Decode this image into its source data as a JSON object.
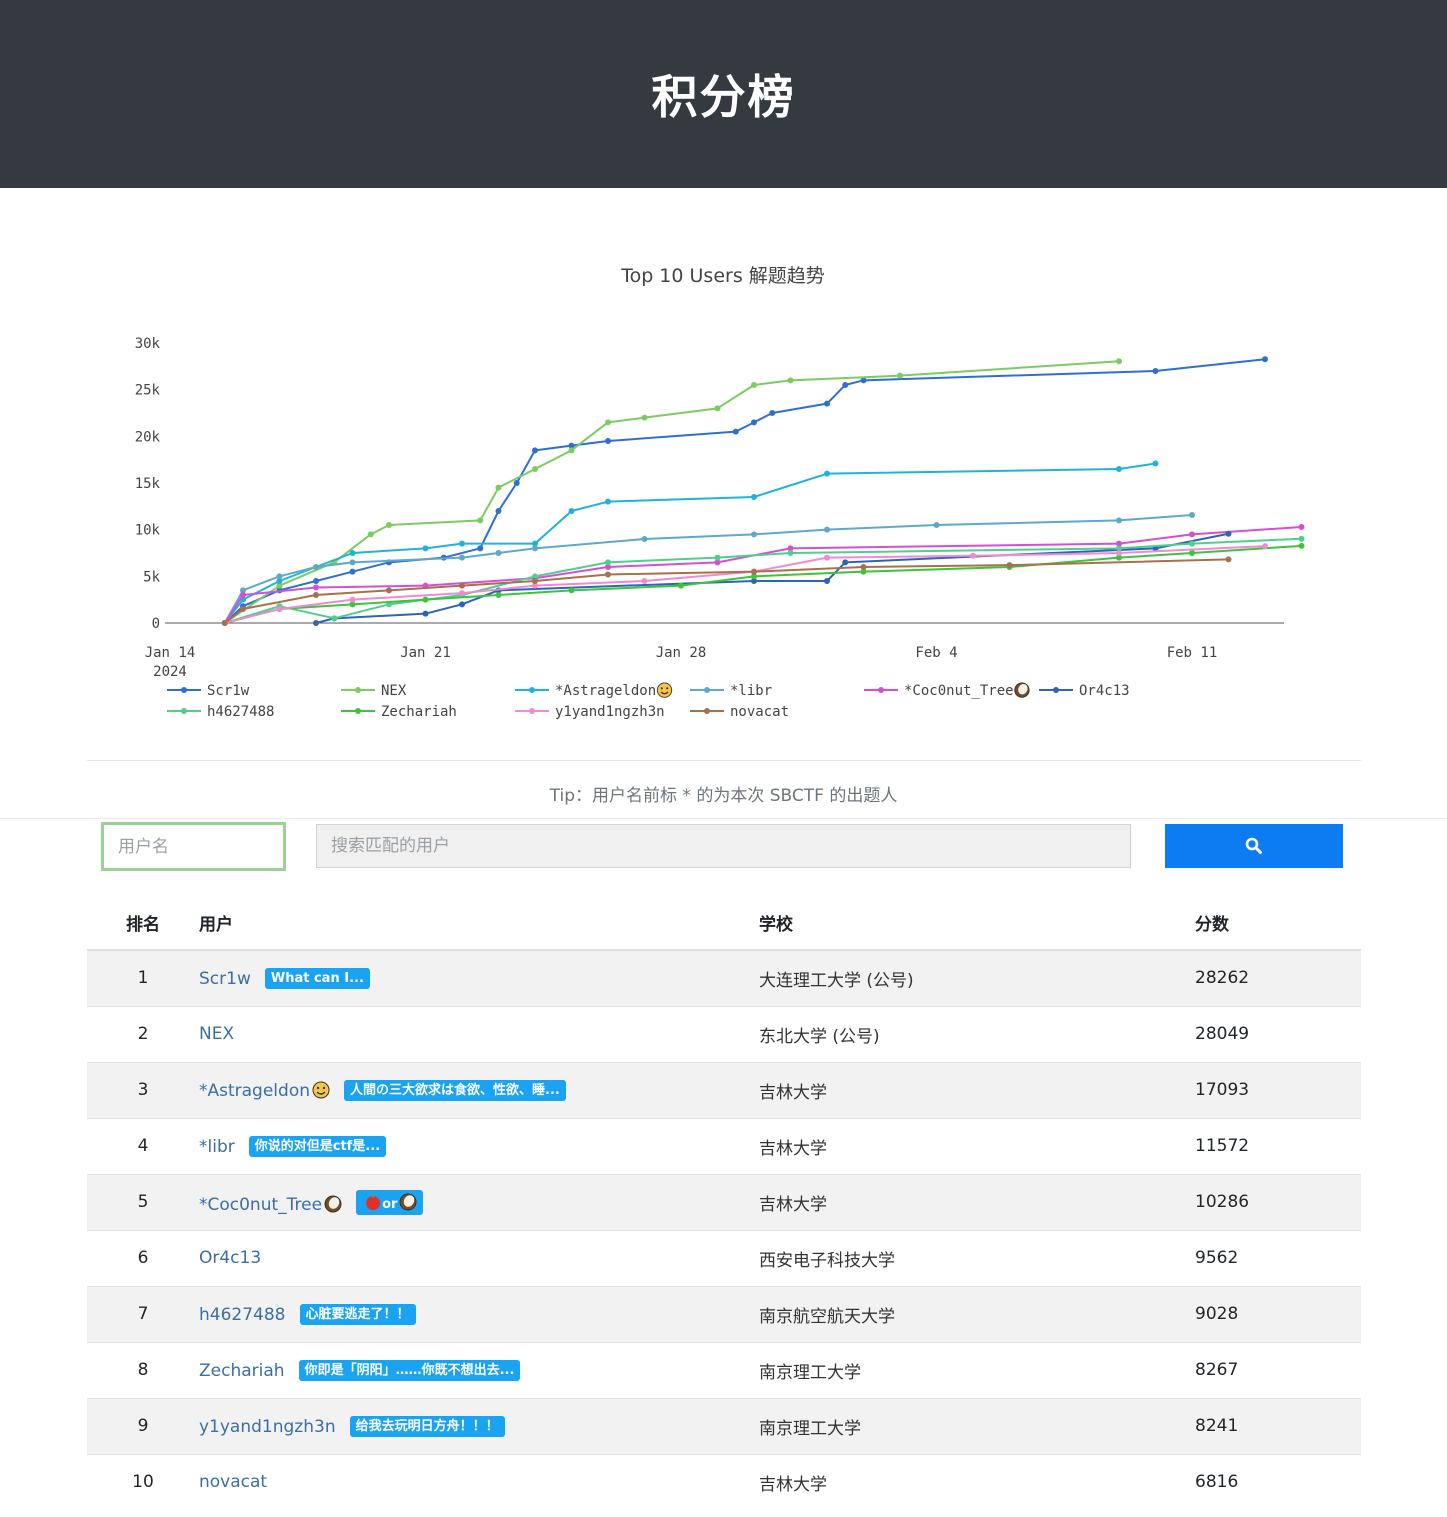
{
  "header": {
    "title": "积分榜"
  },
  "chart_data": {
    "type": "line",
    "title": "Top 10 Users 解题趋势",
    "x_ticks": [
      "Jan 14\n2024",
      "Jan 21",
      "Jan 28",
      "Feb 4",
      "Feb 11"
    ],
    "y_ticks": [
      "0",
      "5k",
      "10k",
      "15k",
      "20k",
      "25k",
      "30k"
    ],
    "ylim": [
      0,
      30000
    ],
    "xlim": [
      "2024-01-14",
      "2024-02-14"
    ],
    "grid": false,
    "legend_position": "bottom",
    "series": [
      {
        "name": "Scr1w",
        "color": "#2e6fd1",
        "points": [
          [
            "2024-01-15T12:00",
            0
          ],
          [
            "2024-01-16T00:00",
            1800
          ],
          [
            "2024-01-17T00:00",
            3500
          ],
          [
            "2024-01-18T00:00",
            4500
          ],
          [
            "2024-01-19T00:00",
            5500
          ],
          [
            "2024-01-20T00:00",
            6500
          ],
          [
            "2024-01-21T12:00",
            7000
          ],
          [
            "2024-01-22T12:00",
            8000
          ],
          [
            "2024-01-23T00:00",
            12000
          ],
          [
            "2024-01-23T12:00",
            15000
          ],
          [
            "2024-01-24T00:00",
            18500
          ],
          [
            "2024-01-25T00:00",
            19000
          ],
          [
            "2024-01-26T00:00",
            19500
          ],
          [
            "2024-01-29T12:00",
            20500
          ],
          [
            "2024-01-30T00:00",
            21500
          ],
          [
            "2024-01-30T12:00",
            22500
          ],
          [
            "2024-02-01T00:00",
            23500
          ],
          [
            "2024-02-01T12:00",
            25500
          ],
          [
            "2024-02-02T00:00",
            26000
          ],
          [
            "2024-02-10T00:00",
            27000
          ],
          [
            "2024-02-13T00:00",
            28262
          ]
        ]
      },
      {
        "name": "NEX",
        "color": "#7ccc5f",
        "points": [
          [
            "2024-01-15T12:00",
            0
          ],
          [
            "2024-01-17T00:00",
            4000
          ],
          [
            "2024-01-18T12:00",
            6500
          ],
          [
            "2024-01-19T12:00",
            9500
          ],
          [
            "2024-01-20T00:00",
            10500
          ],
          [
            "2024-01-22T12:00",
            11000
          ],
          [
            "2024-01-23T00:00",
            14500
          ],
          [
            "2024-01-24T00:00",
            16500
          ],
          [
            "2024-01-25T00:00",
            18500
          ],
          [
            "2024-01-26T00:00",
            21500
          ],
          [
            "2024-01-27T00:00",
            22000
          ],
          [
            "2024-01-29T00:00",
            23000
          ],
          [
            "2024-01-30T00:00",
            25500
          ],
          [
            "2024-01-31T00:00",
            26000
          ],
          [
            "2024-02-03T00:00",
            26500
          ],
          [
            "2024-02-09T00:00",
            28049
          ]
        ]
      },
      {
        "name": "*Astrageldon",
        "color": "#1fb3d9",
        "points": [
          [
            "2024-01-15T12:00",
            0
          ],
          [
            "2024-01-16T00:00",
            2500
          ],
          [
            "2024-01-17T00:00",
            4500
          ],
          [
            "2024-01-19T00:00",
            7500
          ],
          [
            "2024-01-21T00:00",
            8000
          ],
          [
            "2024-01-22T00:00",
            8500
          ],
          [
            "2024-01-24T00:00",
            8500
          ],
          [
            "2024-01-25T00:00",
            12000
          ],
          [
            "2024-01-26T00:00",
            13000
          ],
          [
            "2024-01-30T00:00",
            13500
          ],
          [
            "2024-02-01T00:00",
            16000
          ],
          [
            "2024-02-09T00:00",
            16500
          ],
          [
            "2024-02-10T00:00",
            17093
          ]
        ]
      },
      {
        "name": "*libr",
        "color": "#5ea9c9",
        "points": [
          [
            "2024-01-15T12:00",
            0
          ],
          [
            "2024-01-16T00:00",
            3500
          ],
          [
            "2024-01-17T00:00",
            5000
          ],
          [
            "2024-01-18T00:00",
            6000
          ],
          [
            "2024-01-19T00:00",
            6500
          ],
          [
            "2024-01-22T00:00",
            7000
          ],
          [
            "2024-01-23T00:00",
            7500
          ],
          [
            "2024-01-24T00:00",
            8000
          ],
          [
            "2024-01-27T00:00",
            9000
          ],
          [
            "2024-01-30T00:00",
            9500
          ],
          [
            "2024-02-01T00:00",
            10000
          ],
          [
            "2024-02-04T00:00",
            10500
          ],
          [
            "2024-02-09T00:00",
            11000
          ],
          [
            "2024-02-11T00:00",
            11572
          ]
        ]
      },
      {
        "name": "*Coc0nut_Tree",
        "color": "#d44fd6",
        "points": [
          [
            "2024-01-15T12:00",
            0
          ],
          [
            "2024-01-16T00:00",
            3000
          ],
          [
            "2024-01-18T00:00",
            3800
          ],
          [
            "2024-01-21T00:00",
            4000
          ],
          [
            "2024-01-24T00:00",
            4800
          ],
          [
            "2024-01-26T00:00",
            6000
          ],
          [
            "2024-01-29T00:00",
            6500
          ],
          [
            "2024-01-31T00:00",
            8000
          ],
          [
            "2024-02-09T00:00",
            8500
          ],
          [
            "2024-02-11T00:00",
            9500
          ],
          [
            "2024-02-14T00:00",
            10286
          ]
        ]
      },
      {
        "name": "Or4c13",
        "color": "#2a66b5",
        "points": [
          [
            "2024-01-18T00:00",
            0
          ],
          [
            "2024-01-18T12:00",
            500
          ],
          [
            "2024-01-21T00:00",
            1000
          ],
          [
            "2024-01-22T00:00",
            2000
          ],
          [
            "2024-01-23T00:00",
            3500
          ],
          [
            "2024-01-30T00:00",
            4500
          ],
          [
            "2024-02-01T00:00",
            4500
          ],
          [
            "2024-02-01T12:00",
            6500
          ],
          [
            "2024-02-10T00:00",
            8000
          ],
          [
            "2024-02-12T00:00",
            9562
          ]
        ]
      },
      {
        "name": "h4627488",
        "color": "#4fcf8d",
        "points": [
          [
            "2024-01-15T12:00",
            0
          ],
          [
            "2024-01-17T00:00",
            1800
          ],
          [
            "2024-01-18T12:00",
            500
          ],
          [
            "2024-01-20T00:00",
            2000
          ],
          [
            "2024-01-22T00:00",
            3000
          ],
          [
            "2024-01-24T00:00",
            5000
          ],
          [
            "2024-01-26T00:00",
            6500
          ],
          [
            "2024-01-29T00:00",
            7000
          ],
          [
            "2024-01-31T00:00",
            7500
          ],
          [
            "2024-02-09T00:00",
            8000
          ],
          [
            "2024-02-11T00:00",
            8500
          ],
          [
            "2024-02-14T00:00",
            9028
          ]
        ]
      },
      {
        "name": "Zechariah",
        "color": "#3cc43c",
        "points": [
          [
            "2024-01-15T12:00",
            0
          ],
          [
            "2024-01-17T00:00",
            1500
          ],
          [
            "2024-01-19T00:00",
            2000
          ],
          [
            "2024-01-21T00:00",
            2500
          ],
          [
            "2024-01-23T00:00",
            3000
          ],
          [
            "2024-01-25T00:00",
            3500
          ],
          [
            "2024-01-28T00:00",
            4000
          ],
          [
            "2024-01-30T00:00",
            5000
          ],
          [
            "2024-02-02T00:00",
            5500
          ],
          [
            "2024-02-06T00:00",
            6000
          ],
          [
            "2024-02-09T00:00",
            7000
          ],
          [
            "2024-02-11T00:00",
            7500
          ],
          [
            "2024-02-14T00:00",
            8267
          ]
        ]
      },
      {
        "name": "y1yand1ngzh3n",
        "color": "#f08ad4",
        "points": [
          [
            "2024-01-15T12:00",
            0
          ],
          [
            "2024-01-17T00:00",
            1500
          ],
          [
            "2024-01-19T00:00",
            2500
          ],
          [
            "2024-01-22T00:00",
            3200
          ],
          [
            "2024-01-24T00:00",
            4000
          ],
          [
            "2024-01-27T00:00",
            4500
          ],
          [
            "2024-01-30T00:00",
            5500
          ],
          [
            "2024-02-01T00:00",
            7000
          ],
          [
            "2024-02-05T00:00",
            7200
          ],
          [
            "2024-02-09T00:00",
            7500
          ],
          [
            "2024-02-13T00:00",
            8241
          ]
        ]
      },
      {
        "name": "novacat",
        "color": "#a8704b",
        "points": [
          [
            "2024-01-15T12:00",
            0
          ],
          [
            "2024-01-16T00:00",
            1500
          ],
          [
            "2024-01-18T00:00",
            3000
          ],
          [
            "2024-01-20T00:00",
            3500
          ],
          [
            "2024-01-22T00:00",
            4000
          ],
          [
            "2024-01-24T00:00",
            4500
          ],
          [
            "2024-01-26T00:00",
            5200
          ],
          [
            "2024-01-30T00:00",
            5500
          ],
          [
            "2024-02-02T00:00",
            6000
          ],
          [
            "2024-02-06T00:00",
            6200
          ],
          [
            "2024-02-12T00:00",
            6816
          ]
        ]
      }
    ]
  },
  "tip": "Tip：用户名前标 * 的为本次 SBCTF 的出题人",
  "search": {
    "user_placeholder": "用户名",
    "match_placeholder": "搜索匹配的用户",
    "button_icon": "search-icon"
  },
  "table": {
    "headers": {
      "rank": "排名",
      "user": "用户",
      "school": "学校",
      "score": "分数"
    },
    "rows": [
      {
        "rank": "1",
        "user": "Scr1w",
        "badge": "What can I...",
        "school": "大连理工大学 (公号)",
        "score": "28262"
      },
      {
        "rank": "2",
        "user": "NEX",
        "badge": "",
        "school": "东北大学 (公号)",
        "score": "28049"
      },
      {
        "rank": "3",
        "user": "*Astrageldon",
        "emoji": "smiling-face-icon",
        "badge": "人間の三大欲求は食欲、性欲、睡...",
        "school": "吉林大学",
        "score": "17093"
      },
      {
        "rank": "4",
        "user": "*libr",
        "badge": "你说的对但是ctf是...",
        "school": "吉林大学",
        "score": "11572"
      },
      {
        "rank": "5",
        "user": "*Coc0nut_Tree",
        "emoji": "coconut-icon",
        "badge": "or",
        "badge_icons": [
          "apple-icon",
          "coconut-icon"
        ],
        "school": "吉林大学",
        "score": "10286"
      },
      {
        "rank": "6",
        "user": "Or4c13",
        "badge": "",
        "school": "西安电子科技大学",
        "score": "9562"
      },
      {
        "rank": "7",
        "user": "h4627488",
        "badge": "心脏要逃走了！！",
        "school": "南京航空航天大学",
        "score": "9028"
      },
      {
        "rank": "8",
        "user": "Zechariah",
        "badge": "你即是「阴阳」……你既不想出去...",
        "school": "南京理工大学",
        "score": "8267"
      },
      {
        "rank": "9",
        "user": "y1yand1ngzh3n",
        "badge": "给我去玩明日方舟！！！",
        "school": "南京理工大学",
        "score": "8241"
      },
      {
        "rank": "10",
        "user": "novacat",
        "badge": "",
        "school": "吉林大学",
        "score": "6816"
      }
    ]
  }
}
